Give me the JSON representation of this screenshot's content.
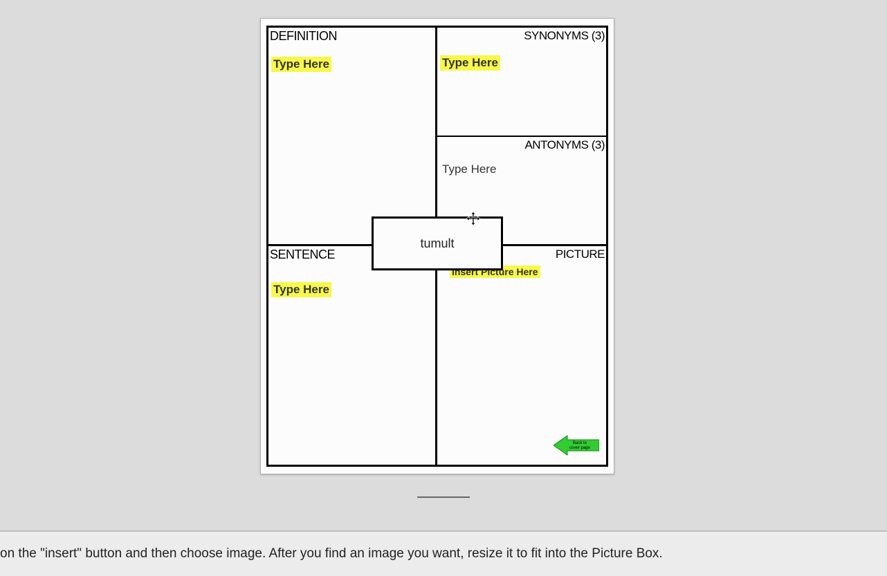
{
  "worksheet": {
    "definition": {
      "label": "DEFINITION",
      "placeholder": "Type Here"
    },
    "synonyms": {
      "label": "SYNONYMS (3)",
      "placeholder": "Type Here"
    },
    "antonyms": {
      "label": "ANTONYMS (3)",
      "placeholder": "Type Here"
    },
    "sentence": {
      "label": "SENTENCE",
      "placeholder": "Type Here"
    },
    "picture": {
      "label": "PICTURE",
      "placeholder": "Insert Picture Here"
    },
    "center_word": "tumult",
    "back_button": "Back to cover page"
  },
  "instruction": "on the \"insert\" button and then choose image. After you find an image you want, resize it to fit into the Picture Box."
}
